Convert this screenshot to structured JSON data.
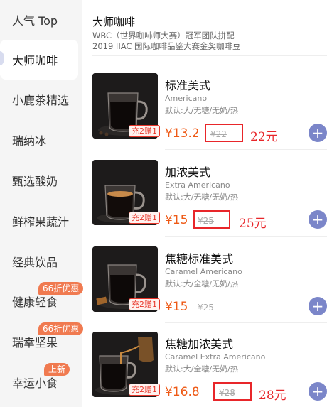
{
  "sidebar": {
    "items": [
      {
        "label": "人气 Top",
        "active": false,
        "badge": ""
      },
      {
        "label": "大师咖啡",
        "active": true,
        "badge": ""
      },
      {
        "label": "小鹿茶精选",
        "active": false,
        "badge": ""
      },
      {
        "label": "瑞纳冰",
        "active": false,
        "badge": ""
      },
      {
        "label": "甄选酸奶",
        "active": false,
        "badge": ""
      },
      {
        "label": "鲜榨果蔬汁",
        "active": false,
        "badge": ""
      },
      {
        "label": "经典饮品",
        "active": false,
        "badge": ""
      },
      {
        "label": "健康轻食",
        "active": false,
        "badge": "66折优惠"
      },
      {
        "label": "瑞幸坚果",
        "active": false,
        "badge": "66折优惠"
      },
      {
        "label": "幸运小食",
        "active": false,
        "badge": "上新"
      }
    ]
  },
  "category": {
    "title": "大师咖啡",
    "desc_line1": "WBC（世界咖啡师大赛）冠军团队拼配",
    "desc_line2": "2019 IIAC 国际咖啡品鉴大赛金奖咖啡豆"
  },
  "products": [
    {
      "name": "标准美式",
      "en": "Americano",
      "spec": "默认:大/无糖/无奶/热",
      "price": "¥13.2",
      "orig": "¥22",
      "promo": "充2赠1",
      "note": "22元",
      "add": "+"
    },
    {
      "name": "加浓美式",
      "en": "Extra Americano",
      "spec": "默认:大/无糖/无奶/热",
      "price": "¥15",
      "orig": "¥25",
      "promo": "充2赠1",
      "note": "25元",
      "add": "+"
    },
    {
      "name": "焦糖标准美式",
      "en": "Caramel Americano",
      "spec": "默认:大/全糖/无奶/热",
      "price": "¥15",
      "orig": "¥25",
      "promo": "充2赠1",
      "note": "",
      "add": "+"
    },
    {
      "name": "焦糖加浓美式",
      "en": "Caramel Extra Americano",
      "spec": "默认:大/全糖/无奶/热",
      "price": "¥16.8",
      "orig": "¥28",
      "promo": "充2赠1",
      "note": "28元",
      "add": "+"
    }
  ],
  "colors": {
    "accent": "#7b86c9",
    "price": "#ee5a16",
    "badge": "#f07a50",
    "annotation": "#e8262a"
  }
}
